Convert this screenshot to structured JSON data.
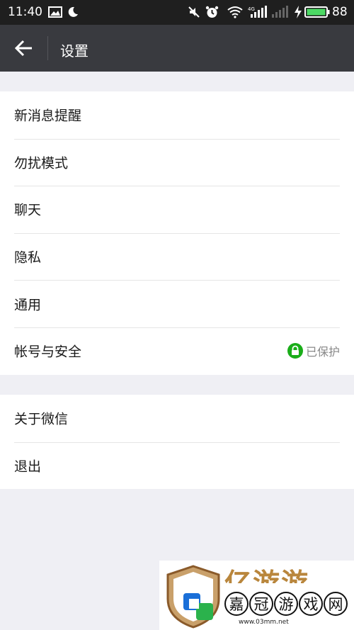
{
  "status_bar": {
    "time": "11:40",
    "network_label": "4G",
    "battery_level": "88",
    "icons": [
      "image-icon",
      "moon-icon",
      "mute-icon",
      "alarm-icon",
      "wifi-icon",
      "signal-icon",
      "signal-empty-icon",
      "charging-icon",
      "battery-icon"
    ]
  },
  "header": {
    "title": "设置",
    "back_icon": "arrow-left-icon",
    "background": "#393a3f"
  },
  "settings": {
    "group1": [
      {
        "label": "新消息提醒"
      },
      {
        "label": "勿扰模式"
      },
      {
        "label": "聊天"
      },
      {
        "label": "隐私"
      },
      {
        "label": "通用"
      },
      {
        "label": "帐号与安全",
        "status": "已保护",
        "status_icon": "lock-icon",
        "status_color": "#1aad19"
      }
    ],
    "group2": [
      {
        "label": "关于微信"
      },
      {
        "label": "退出"
      }
    ]
  },
  "watermark": {
    "partial_text": "亿游游",
    "chars": [
      "嘉",
      "冠",
      "游",
      "戏",
      "网"
    ],
    "url": "www.03mm.net"
  }
}
